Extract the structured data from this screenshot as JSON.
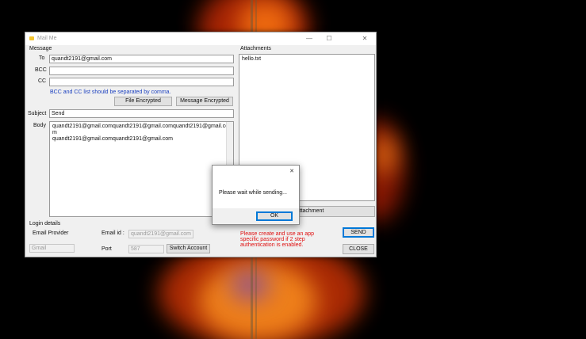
{
  "window": {
    "title": "Mail Me",
    "controls": {
      "minimize": "—",
      "maximize": "☐",
      "close": "✕"
    }
  },
  "message": {
    "section_label": "Message",
    "to_label": "To",
    "to_value": "quandt2191@gmail.com",
    "bcc_label": "BCC",
    "bcc_value": "",
    "cc_label": "CC",
    "cc_value": "",
    "hint": "BCC and CC list should be separated by comma.",
    "file_encrypted_button": "File Encrypted",
    "message_encrypted_button": "Message Encrypted",
    "subject_label": "Subject",
    "subject_value": "Send",
    "body_label": "Body",
    "body_lines": [
      "quandt2191@gmail.comquandt2191@gmail.comquandt2191@gmail.co",
      "m",
      "quandt2191@gmail.comquandt2191@gmail.com"
    ]
  },
  "attachments": {
    "section_label": "Attachments",
    "items": [
      "hello.txt"
    ],
    "add_button_partial": "ttachment"
  },
  "login": {
    "section_label": "Login details",
    "email_provider_label": "Email Provider",
    "email_provider_value": "Gmail",
    "email_id_label": "Email id :",
    "email_id_value": "quandt2191@gmail.com",
    "port_label": "Port",
    "port_value": "587",
    "switch_account_button": "Switch Account"
  },
  "warning": "Please create and use an app specific password if 2 step authentication is enabled.",
  "actions": {
    "send_button": "SEND",
    "close_button": "CLOSE"
  },
  "dialog": {
    "close_glyph": "✕",
    "message": "Please wait while sending...",
    "ok_button": "OK"
  },
  "colors": {
    "hint_blue": "#1a3fbf",
    "warning_red": "#e01010",
    "focus_blue": "#0078d7"
  }
}
